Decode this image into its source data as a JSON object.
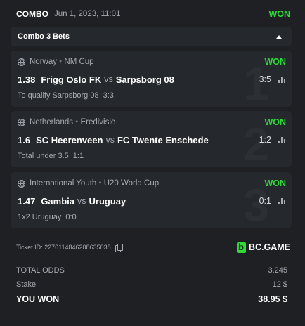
{
  "header": {
    "title": "COMBO",
    "date": "Jun 1, 2023, 11:01",
    "status": "WON"
  },
  "toggle": {
    "label": "Combo 3 Bets"
  },
  "bets": [
    {
      "index": "1",
      "league_country": "Norway",
      "league_name": "NM Cup",
      "status": "WON",
      "odds": "1.38",
      "home": "Frigg Oslo FK",
      "vs": "vs",
      "away": "Sarpsborg 08",
      "score": "3:5",
      "market": "To qualify Sarpsborg 08",
      "market_value": "3:3"
    },
    {
      "index": "2",
      "league_country": "Netherlands",
      "league_name": "Eredivisie",
      "status": "WON",
      "odds": "1.6",
      "home": "SC Heerenveen",
      "vs": "vs",
      "away": "FC Twente Enschede",
      "score": "1:2",
      "market": "Total under 3.5",
      "market_value": "1:1"
    },
    {
      "index": "3",
      "league_country": "International Youth",
      "league_name": "U20 World Cup",
      "status": "WON",
      "odds": "1.47",
      "home": "Gambia",
      "vs": "vs",
      "away": "Uruguay",
      "score": "0:1",
      "market": "1x2 Uruguay",
      "market_value": "0:0"
    }
  ],
  "ticket": {
    "label": "Ticket ID: 2276114846208635038",
    "brand": "BC.GAME"
  },
  "summary": {
    "total_odds_label": "TOTAL ODDS",
    "total_odds_value": "3.245",
    "stake_label": "Stake",
    "stake_value": "12 $",
    "won_label": "YOU WON",
    "won_value": "38.95 $"
  },
  "colors": {
    "background": "#1e2024",
    "card": "#25282c",
    "won": "#2fd93a",
    "muted_text": "#a7abb2"
  },
  "icons": {
    "league": "globe-icon",
    "stats": "bar-chart-icon",
    "copy": "copy-icon",
    "collapse": "caret-up-icon"
  }
}
